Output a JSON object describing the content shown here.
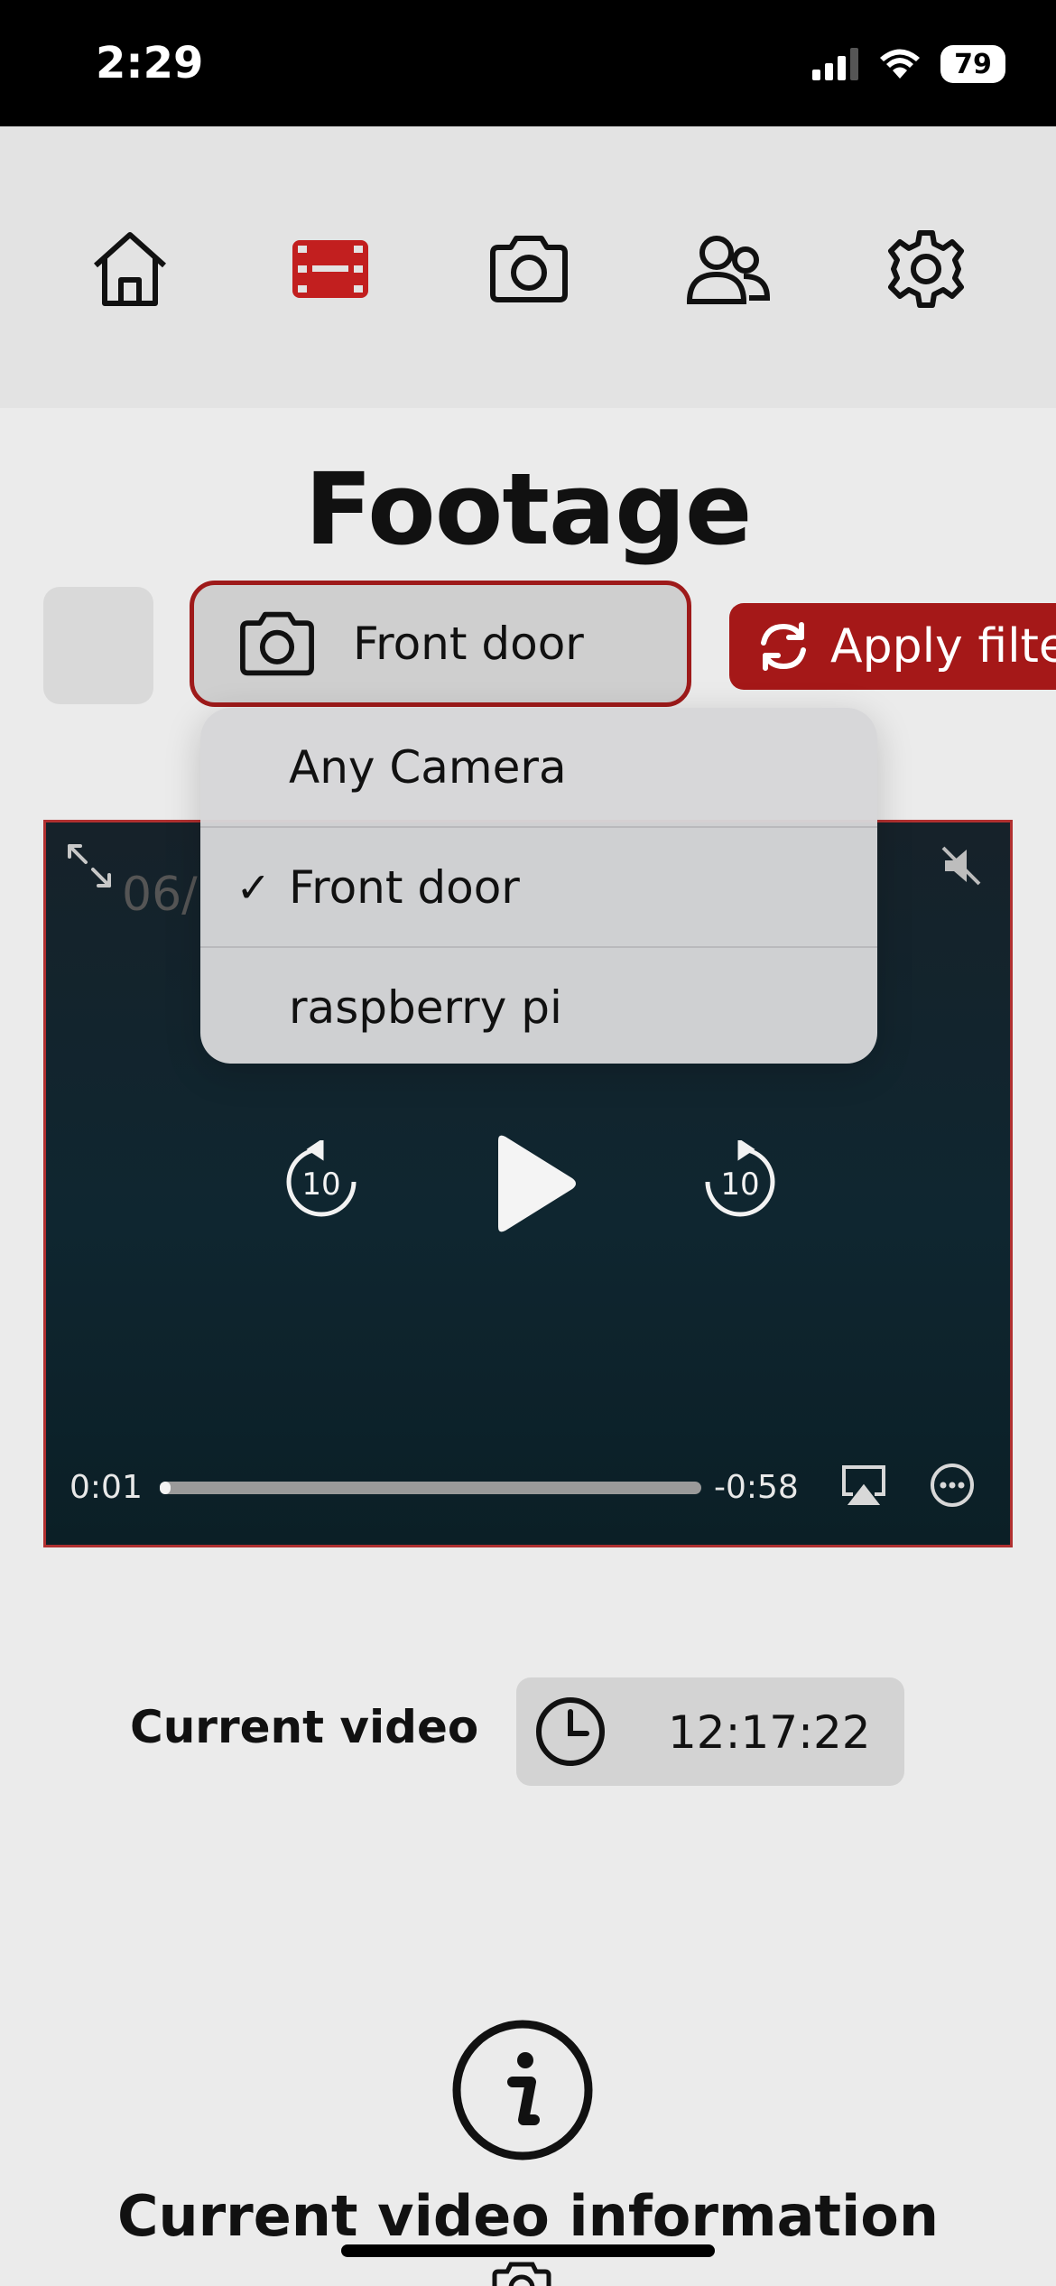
{
  "status_bar": {
    "time": "2:29",
    "battery": "79"
  },
  "nav": {
    "items": [
      {
        "icon": "home-icon",
        "active": false
      },
      {
        "icon": "film-icon",
        "active": true
      },
      {
        "icon": "camera-icon",
        "active": false
      },
      {
        "icon": "users-icon",
        "active": false
      },
      {
        "icon": "gear-icon",
        "active": false
      }
    ],
    "active_color": "#c21f1f"
  },
  "page": {
    "title": "Footage"
  },
  "filters": {
    "camera_selected": "Front door",
    "apply_label": "Apply filter",
    "accent": "#a51818"
  },
  "dropdown": {
    "options": [
      {
        "label": "Any Camera",
        "selected": false
      },
      {
        "label": "Front door",
        "selected": true
      },
      {
        "label": "raspberry pi",
        "selected": false
      }
    ]
  },
  "video": {
    "date_fragment": "06/",
    "elapsed": "0:01",
    "remaining": "-0:58",
    "progress": 0.017,
    "skip_back_seconds": "10",
    "skip_forward_seconds": "10"
  },
  "current_video": {
    "label": "Current video",
    "time": "12:17:22"
  },
  "info": {
    "title": "Current video information"
  }
}
